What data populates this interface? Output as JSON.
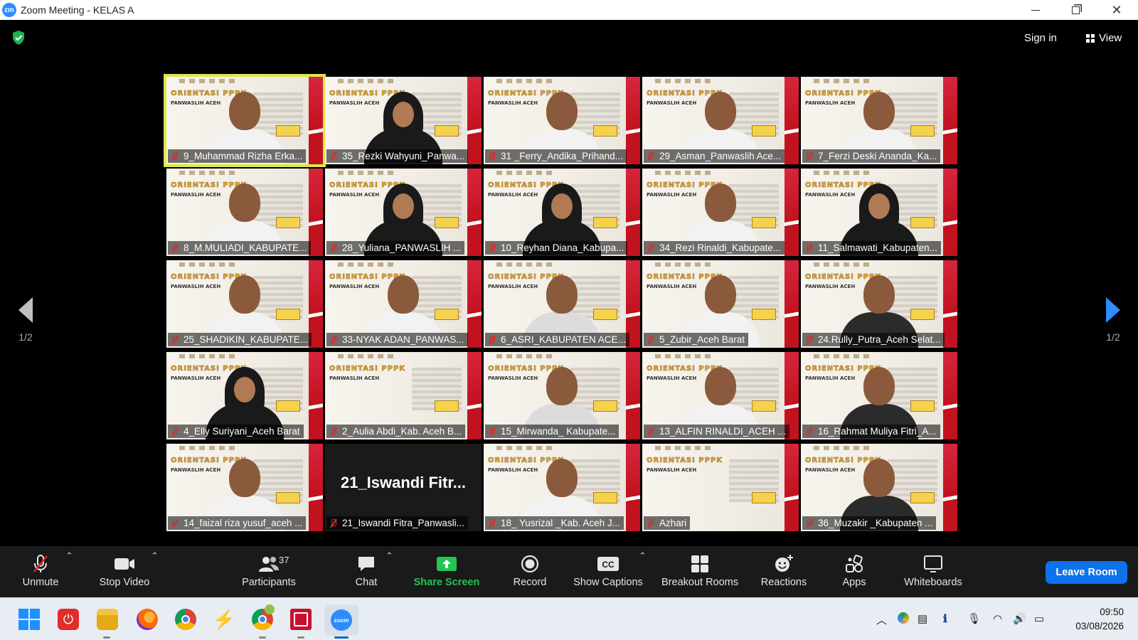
{
  "window": {
    "app_badge": "zm",
    "title": "Zoom Meeting - KELAS A",
    "controls": [
      "minimize",
      "restore",
      "close"
    ]
  },
  "topbar": {
    "security_icon_color": "#1fb14f",
    "sign_in_label": "Sign in",
    "view_label": "View"
  },
  "gallery": {
    "page_left": "1/2",
    "page_right": "1/2",
    "tile_banner": {
      "heading": "ORIENTASI PPPK",
      "subheading": "PANWASLIH ACEH"
    },
    "participants": [
      {
        "name": "9_Muhammad Rizha Erka...",
        "video": "person",
        "active": true
      },
      {
        "name": "35_Rezki Wahyuni_Panwa...",
        "video": "hijab"
      },
      {
        "name": "31 _Ferry_Andika_Prihand...",
        "video": "person"
      },
      {
        "name": "29_Asman_Panwaslih Ace...",
        "video": "person"
      },
      {
        "name": "7_Ferzi Deski Ananda_Ka...",
        "video": "person"
      },
      {
        "name": "8_M.MULIADI_KABUPATE...",
        "video": "person"
      },
      {
        "name": "28_Yuliana_PANWASLIH ...",
        "video": "hijab"
      },
      {
        "name": "10_Reyhan Diana_Kabupa...",
        "video": "hijab"
      },
      {
        "name": "34_Rezi Rinaldi_Kabupate...",
        "video": "person"
      },
      {
        "name": "11_Salmawati_Kabupaten...",
        "video": "hijab"
      },
      {
        "name": "25_SHADIKIN_KABUPATE...",
        "video": "person"
      },
      {
        "name": "33-NYAK ADAN_PANWAS...",
        "video": "person"
      },
      {
        "name": "6_ASRI_KABUPATEN ACE...",
        "video": "gray"
      },
      {
        "name": "5_Zubir_Aceh Barat",
        "video": "person"
      },
      {
        "name": "24.Rully_Putra_Aceh Selat...",
        "video": "dark"
      },
      {
        "name": "4_Elly Suriyani_Aceh Barat",
        "video": "hijab"
      },
      {
        "name": "2_Aulia Abdi_Kab. Aceh B...",
        "video": "none"
      },
      {
        "name": "15_Mirwanda_ Kabupate...",
        "video": "gray"
      },
      {
        "name": "13_ALFIN RINALDI_ACEH ...",
        "video": "person"
      },
      {
        "name": "16_Rahmat Muliya Fitri_A...",
        "video": "dark"
      },
      {
        "name": "14_faizal riza yusuf_aceh ...",
        "video": "person"
      },
      {
        "name": "21_Iswandi Fitra_Panwasli...",
        "video": "off",
        "display_name": "21_Iswandi  Fitr..."
      },
      {
        "name": "18_ Yusrizal _Kab. Aceh J...",
        "video": "person"
      },
      {
        "name": "Azhari",
        "video": "none"
      },
      {
        "name": "36_Muzakir _Kabupaten ...",
        "video": "dark"
      }
    ]
  },
  "toolbar": {
    "unmute": "Unmute",
    "stop_video": "Stop Video",
    "participants": "Participants",
    "participants_count": "37",
    "chat": "Chat",
    "share_screen": "Share Screen",
    "record": "Record",
    "show_captions": "Show Captions",
    "breakout_rooms": "Breakout Rooms",
    "reactions": "Reactions",
    "apps": "Apps",
    "whiteboards": "Whiteboards",
    "leave_room": "Leave Room",
    "share_color": "#23c552",
    "leave_color": "#0e72ed"
  },
  "taskbar": {
    "apps": [
      "windows-start-icon",
      "power-app-icon",
      "file-explorer-icon",
      "firefox-icon",
      "chrome-icon",
      "lightning-app-icon",
      "chrome-profile-icon",
      "acrobat-icon",
      "zoom-icon"
    ],
    "time": "09:50",
    "date": "03/08/2026"
  }
}
